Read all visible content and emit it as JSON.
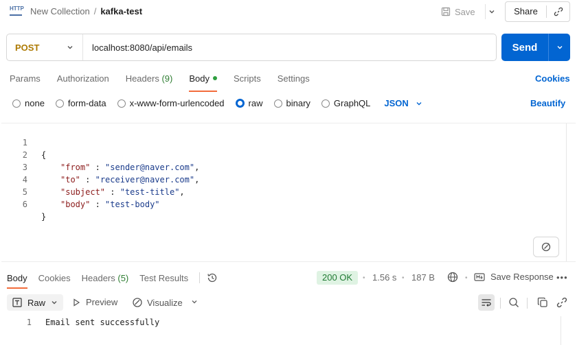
{
  "header": {
    "method_icon_text": "HTTP",
    "collection": "New Collection",
    "separator": "/",
    "request_name": "kafka-test",
    "save_label": "Save",
    "share_label": "Share"
  },
  "request": {
    "method": "POST",
    "url": "localhost:8080/api/emails",
    "send_label": "Send"
  },
  "request_tabs": [
    {
      "label": "Params"
    },
    {
      "label": "Authorization"
    },
    {
      "label": "Headers",
      "count": "(9)"
    },
    {
      "label": "Body",
      "active": true
    },
    {
      "label": "Scripts"
    },
    {
      "label": "Settings"
    }
  ],
  "cookies_label": "Cookies",
  "body_options": {
    "none": "none",
    "form_data": "form-data",
    "urlencoded": "x-www-form-urlencoded",
    "raw": "raw",
    "binary": "binary",
    "graphql": "GraphQL",
    "format": "JSON",
    "beautify": "Beautify"
  },
  "editor_lines": [
    {
      "n": "1",
      "text": "{"
    },
    {
      "n": "2",
      "key": "\"from\"",
      "sep": " : ",
      "val": "\"sender@naver.com\"",
      "end": ","
    },
    {
      "n": "3",
      "key": "\"to\"",
      "sep": " : ",
      "val": "\"receiver@naver.com\"",
      "end": ","
    },
    {
      "n": "4",
      "key": "\"subject\"",
      "sep": " : ",
      "val": "\"test-title\"",
      "end": ","
    },
    {
      "n": "5",
      "key": "\"body\"",
      "sep": " : ",
      "val": "\"test-body\"",
      "end": ""
    },
    {
      "n": "6",
      "text": "}"
    }
  ],
  "response": {
    "tabs": {
      "body": "Body",
      "cookies": "Cookies",
      "headers": "Headers",
      "headers_count": "(5)",
      "test_results": "Test Results"
    },
    "status": "200 OK",
    "time": "1.56 s",
    "size": "187 B",
    "save_response": "Save Response",
    "view_mode": "Raw",
    "preview": "Preview",
    "visualize": "Visualize",
    "line_number": "1",
    "body_text": "Email sent successfully"
  },
  "colors": {
    "accent": "#0265d2",
    "method_post": "#ad7a03",
    "tab_underline": "#f26b3a",
    "status_ok_bg": "#dff3e3",
    "status_ok_text": "#1f7a32"
  }
}
